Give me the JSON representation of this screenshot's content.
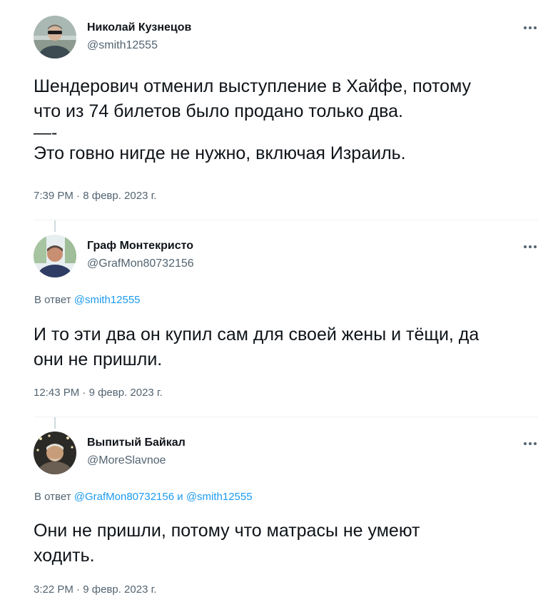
{
  "tweets": [
    {
      "author_name": "Николай Кузнецов",
      "author_handle": "@smith12555",
      "text_lines": [
        "Шендерович отменил выступление в Хайфе, потому",
        "что из 74 билетов было продано только два.",
        "—-",
        "Это говно нигде не нужно, включая Израиль."
      ],
      "time": "7:39 PM",
      "date": "8 февр. 2023 г."
    },
    {
      "author_name": "Граф Монтекристо",
      "author_handle": "@GrafMon80732156",
      "reply_prefix": "В ответ",
      "reply_mentions": [
        "@smith12555"
      ],
      "text_lines": [
        "И то эти два он купил сам для своей жены и тёщи, да",
        "они не пришли."
      ],
      "time": "12:43 PM",
      "date": "9 февр. 2023 г."
    },
    {
      "author_name": "Выпитый Байкал",
      "author_handle": "@MoreSlavnoe",
      "reply_prefix": "В ответ",
      "reply_mentions": [
        "@GrafMon80732156",
        "@smith12555"
      ],
      "reply_conjunction": "и",
      "text_lines": [
        "Они не пришли, потому что матрасы не умеют",
        "ходить."
      ],
      "time": "3:22 PM",
      "date": "9 февр. 2023 г."
    }
  ],
  "separator": "·",
  "icons": {
    "more": "more-horizontal-icon"
  },
  "colors": {
    "text": "#0f1419",
    "secondary": "#536471",
    "link": "#1d9bf0",
    "divider": "#eff3f4"
  }
}
